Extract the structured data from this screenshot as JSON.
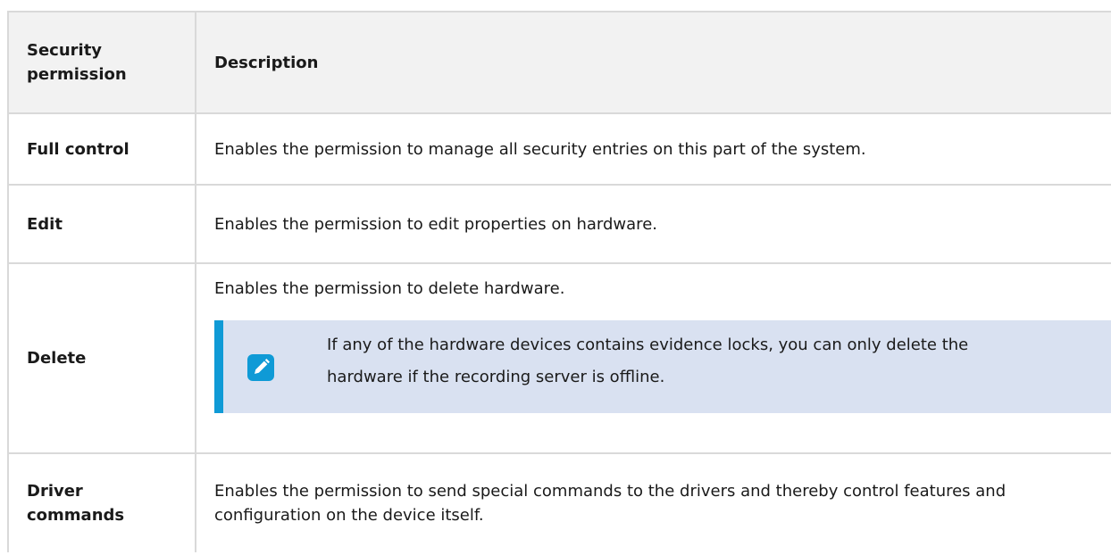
{
  "table": {
    "headers": {
      "permission": "Security permission",
      "description": "Description"
    },
    "rows": [
      {
        "permission": "Full control",
        "description": "Enables the permission to manage all security entries on this part of the system."
      },
      {
        "permission": "Edit",
        "description": "Enables the permission to edit properties on hardware."
      },
      {
        "permission": "Delete",
        "description": "Enables the permission to delete hardware.",
        "note": {
          "icon": "pencil-note-icon",
          "text": "If any of the hardware devices contains evidence locks, you can only delete the hardware if the recording server is offline."
        }
      },
      {
        "permission": "Driver commands",
        "description": "Enables the permission to send special commands to the drivers and thereby control features and configuration on the device itself."
      }
    ]
  },
  "colors": {
    "header_background": "#f2f2f2",
    "border": "#d9d9d9",
    "note_background": "#d9e1f1",
    "note_accent": "#0f9ad6"
  }
}
